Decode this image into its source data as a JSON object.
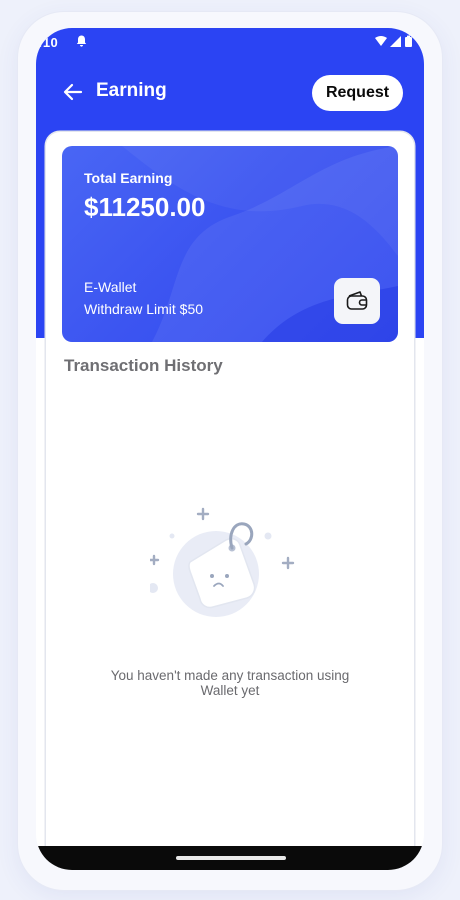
{
  "status_bar": {
    "time": ":10"
  },
  "header": {
    "title": "Earning",
    "request_label": "Request"
  },
  "earning_card": {
    "label": "Total Earning",
    "amount": "$11250.00",
    "wallet_label": "E-Wallet",
    "withdraw_limit": "Withdraw Limit $50"
  },
  "history": {
    "title": "Transaction History",
    "empty_message_line1": "You haven't made any transaction using",
    "empty_message_line2": "Wallet yet"
  },
  "icons": {
    "back": "arrow-left-icon",
    "wallet": "wallet-icon",
    "empty": "price-tag-illustration"
  },
  "colors": {
    "primary": "#2b44f3",
    "background": "#eef1fb",
    "text_muted": "#6a6a6e"
  }
}
